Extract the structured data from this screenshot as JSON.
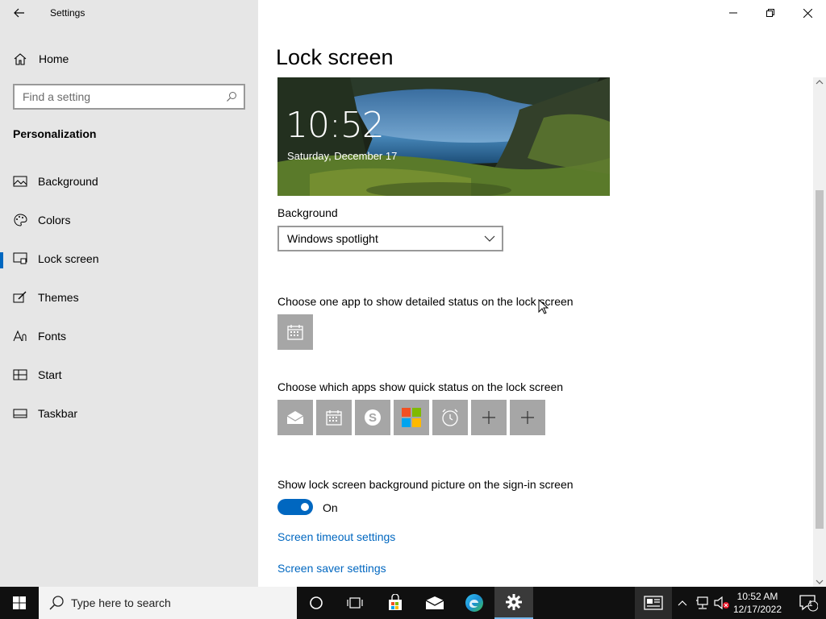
{
  "window": {
    "app_title": "Settings",
    "minimize_glyph": "—",
    "restore_glyph": "❐",
    "close_glyph": "✕"
  },
  "sidebar": {
    "home_label": "Home",
    "search_placeholder": "Find a setting",
    "section_title": "Personalization",
    "items": [
      {
        "label": "Background",
        "icon": "image-icon"
      },
      {
        "label": "Colors",
        "icon": "palette-icon"
      },
      {
        "label": "Lock screen",
        "icon": "lock-screen-icon",
        "selected": true
      },
      {
        "label": "Themes",
        "icon": "brush-icon"
      },
      {
        "label": "Fonts",
        "icon": "font-icon"
      },
      {
        "label": "Start",
        "icon": "start-layout-icon"
      },
      {
        "label": "Taskbar",
        "icon": "taskbar-icon"
      }
    ]
  },
  "main": {
    "title": "Lock screen",
    "preview": {
      "time": "10:52",
      "date": "Saturday, December 17"
    },
    "background_label": "Background",
    "background_value": "Windows spotlight",
    "detailed_status_label": "Choose one app to show detailed status on the lock screen",
    "quick_status_label": "Choose which apps show quick status on the lock screen",
    "quick_status_apps": [
      "mail-icon",
      "calendar-icon",
      "skype-icon",
      "store-icon",
      "alarm-clock-icon",
      "add-icon",
      "add-icon"
    ],
    "signin_label": "Show lock screen background picture on the sign-in screen",
    "toggle_state": "On",
    "toggle_on": true,
    "link_timeout": "Screen timeout settings",
    "link_saver": "Screen saver settings"
  },
  "taskbar": {
    "search_placeholder": "Type here to search",
    "time": "10:52 AM",
    "date": "12/17/2022",
    "notification_count": "1",
    "accent_color": "#0067c0"
  }
}
